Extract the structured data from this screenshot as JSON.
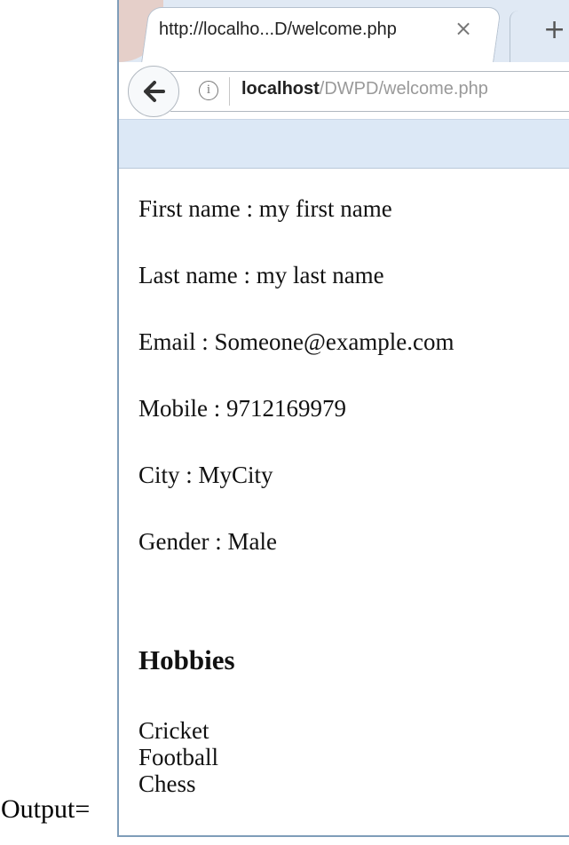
{
  "caption": "Output=",
  "browser": {
    "tab_title": "http://localho...D/welcome.php",
    "tab_close": "×",
    "new_tab": "+",
    "info": "i",
    "url_host": "localhost",
    "url_path": "/DWPD/welcome.php"
  },
  "fields": [
    {
      "label": "First name",
      "value": "my first name",
      "text": "First name : my first name"
    },
    {
      "label": "Last name",
      "value": "my last name",
      "text": "Last name : my last name"
    },
    {
      "label": "Email",
      "value": "Someone@example.com",
      "text": "Email : Someone@example.com"
    },
    {
      "label": "Mobile",
      "value": "9712169979",
      "text": "Mobile : 9712169979"
    },
    {
      "label": "City",
      "value": "MyCity",
      "text": "City : MyCity"
    },
    {
      "label": "Gender",
      "value": "Male",
      "text": "Gender : Male"
    }
  ],
  "hobbies": {
    "heading": "Hobbies",
    "items": [
      "Cricket",
      "Football",
      "Chess"
    ]
  }
}
